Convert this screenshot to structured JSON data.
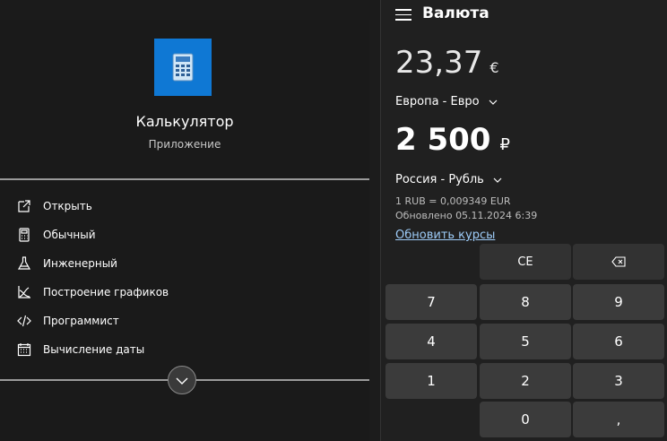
{
  "start_menu": {
    "app_name": "Калькулятор",
    "app_type": "Приложение",
    "items": [
      {
        "label": "Открыть",
        "icon": "open-external-icon"
      },
      {
        "label": "Обычный",
        "icon": "calculator-icon"
      },
      {
        "label": "Инженерный",
        "icon": "flask-icon"
      },
      {
        "label": "Построение графиков",
        "icon": "graph-icon"
      },
      {
        "label": "Программист",
        "icon": "code-icon"
      },
      {
        "label": "Вычисление даты",
        "icon": "calendar-icon"
      }
    ],
    "expand_icon": "chevron-down-icon"
  },
  "calculator": {
    "mode_title": "Валюта",
    "from_value": "23,37",
    "from_symbol": "€",
    "from_currency": "Европа - Евро",
    "to_value": "2 500",
    "to_symbol": "₽",
    "to_currency": "Россия - Рубль",
    "rate": "1 RUB = 0,009349 EUR",
    "updated": "Обновлено 05.11.2024 6:39",
    "update_link": "Обновить курсы",
    "keys": {
      "ce": "CE",
      "k7": "7",
      "k8": "8",
      "k9": "9",
      "k4": "4",
      "k5": "5",
      "k6": "6",
      "k1": "1",
      "k2": "2",
      "k3": "3",
      "k0": "0",
      "decimal": ","
    }
  },
  "colors": {
    "accent": "#0f78d4",
    "link": "#9dcbf7",
    "key": "#3b3b3b"
  }
}
